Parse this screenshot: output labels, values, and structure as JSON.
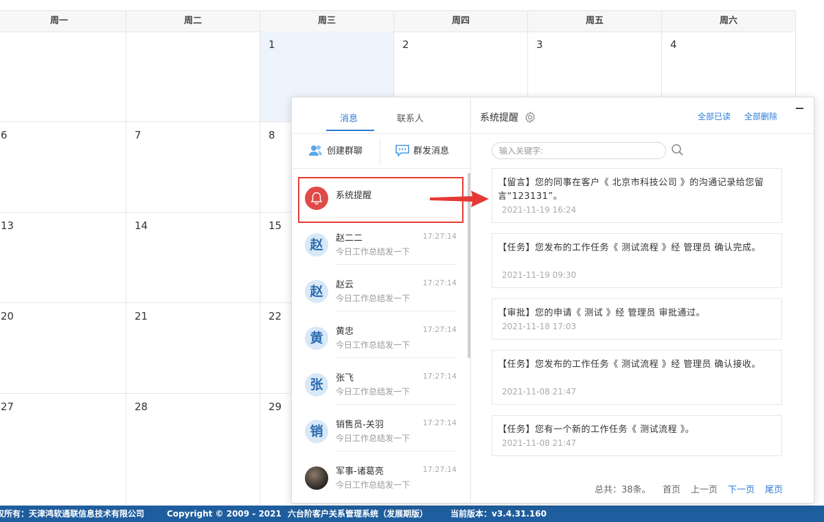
{
  "calendar": {
    "weekdays": [
      "周一",
      "周二",
      "周三",
      "周四",
      "周五",
      "周六"
    ],
    "rows": [
      [
        "",
        "",
        "1",
        "2",
        "3",
        "4"
      ],
      [
        "6",
        "7",
        "8",
        "",
        "",
        ""
      ],
      [
        "13",
        "14",
        "15",
        "",
        "",
        ""
      ],
      [
        "20",
        "21",
        "22",
        "",
        "",
        ""
      ],
      [
        "27",
        "28",
        "29",
        "",
        "",
        ""
      ]
    ]
  },
  "footer": {
    "copyright_owner": "权所有：天津鸿软通联信息技术有限公司",
    "copyright": "Copyright © 2009 - 2021",
    "product": "六台阶客户关系管理系统（发展期版）",
    "version": "当前版本：v3.4.31.160"
  },
  "panel": {
    "tabs": [
      "消息",
      "联系人"
    ],
    "actions": {
      "create_group": "创建群聊",
      "broadcast": "群发消息"
    },
    "system_item": {
      "name": "系统提醒"
    },
    "contacts": [
      {
        "avatar": "赵",
        "name": "赵二二",
        "time": "17:27:14",
        "snippet": "今日工作总结发一下"
      },
      {
        "avatar": "赵",
        "name": "赵云",
        "time": "17:27:14",
        "snippet": "今日工作总结发一下"
      },
      {
        "avatar": "黄",
        "name": "黄忠",
        "time": "17:27:14",
        "snippet": "今日工作总结发一下"
      },
      {
        "avatar": "张",
        "name": "张飞",
        "time": "17:27:14",
        "snippet": "今日工作总结发一下"
      },
      {
        "avatar": "销",
        "name": "销售员-关羽",
        "time": "17:27:14",
        "snippet": "今日工作总结发一下"
      },
      {
        "avatar": "",
        "name": "军事-诸葛亮",
        "time": "17:27:14",
        "snippet": "今日工作总结发一下"
      }
    ],
    "right": {
      "title": "系统提醒",
      "mark_all_read": "全部已读",
      "delete_all": "全部删除",
      "search_placeholder": "输入关键字:",
      "messages": [
        {
          "text": "【留言】您的同事在客户《 北京市科技公司 》的沟通记录给您留言“123131”。",
          "date": "2021-11-19 16:24"
        },
        {
          "text": "【任务】您发布的工作任务《 测试流程 》经 管理员 确认完成。",
          "date": "2021-11-19 09:30"
        },
        {
          "text": "【审批】您的申请《 测试 》经 管理员 审批通过。",
          "date": "2021-11-18 17:03"
        },
        {
          "text": "【任务】您发布的工作任务《 测试流程 》经 管理员 确认接收。",
          "date": "2021-11-08 21:47"
        },
        {
          "text": "【任务】您有一个新的工作任务《 测试流程 》。",
          "date": "2021-11-08 21:47"
        }
      ],
      "pager": {
        "total": "总共：38条。",
        "first": "首页",
        "prev": "上一页",
        "next": "下一页",
        "last": "尾页"
      }
    }
  },
  "colors": {
    "accent": "#2b7bd6",
    "footer_bg": "#1f5e9e",
    "alert_red": "#e53935"
  }
}
